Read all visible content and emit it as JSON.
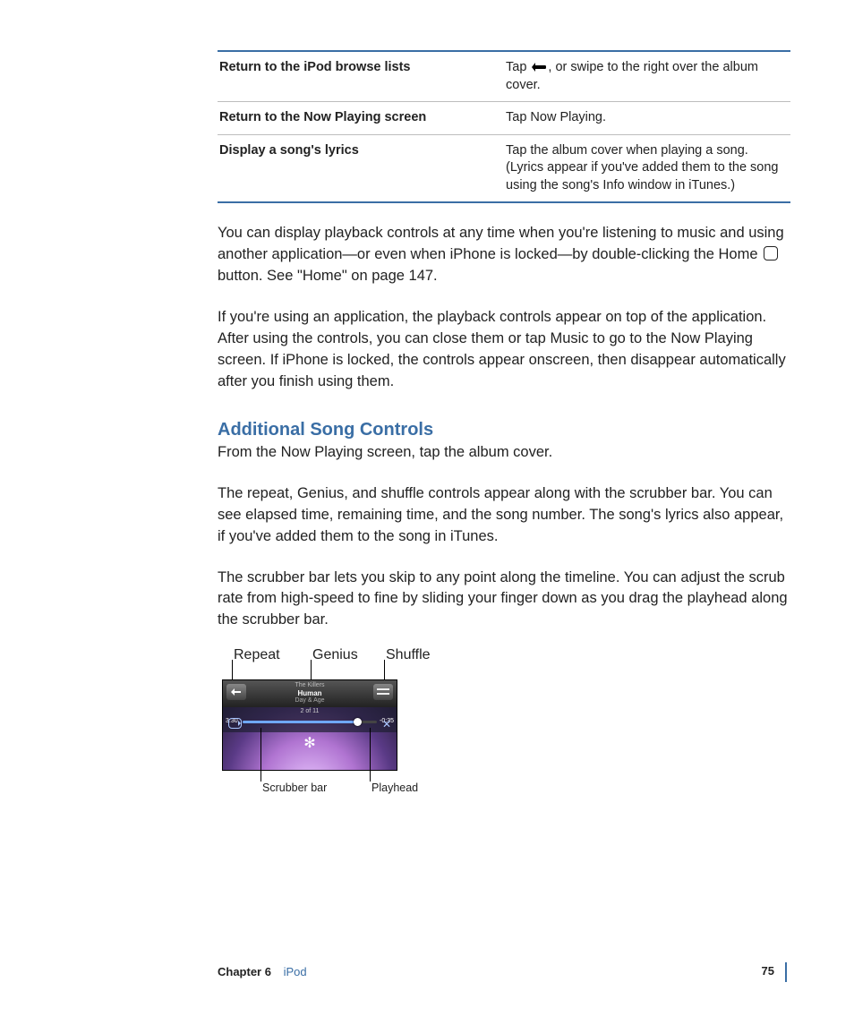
{
  "table": {
    "rows": [
      {
        "left": "Return to the iPod browse lists",
        "right_pre": "Tap ",
        "right_post": ", or swipe to the right over the album cover."
      },
      {
        "left": "Return to the Now Playing screen",
        "right": "Tap Now Playing."
      },
      {
        "left": "Display a song's lyrics",
        "right": "Tap the album cover when playing a song. (Lyrics appear if you've added them to the song using the song's Info window in iTunes.)"
      }
    ]
  },
  "para1_pre": "You can display playback controls at any time when you're listening to music and using another application—or even when iPhone is locked—by double-clicking the Home ",
  "para1_post": " button. See \"Home\" on page 147.",
  "para2": "If you're using an application, the playback controls appear on top of the application. After using the controls, you can close them or tap Music to go to the Now Playing screen. If iPhone is locked, the controls appear onscreen, then disappear automatically after you finish using them.",
  "heading": "Additional Song Controls",
  "para3": "From the Now Playing screen, tap the album cover.",
  "para4": "The repeat, Genius, and shuffle controls appear along with the scrubber bar. You can see elapsed time, remaining time, and the song number. The song's lyrics also appear, if you've added them to the song in iTunes.",
  "para5": "The scrubber bar lets you skip to any point along the timeline. You can adjust the scrub rate from high-speed to fine by sliding your finger down as you drag the playhead along the scrubber bar.",
  "callouts": {
    "repeat": "Repeat",
    "genius": "Genius",
    "shuffle": "Shuffle",
    "scrubber": "Scrubber bar",
    "playhead": "Playhead"
  },
  "now_playing": {
    "artist": "The Killers",
    "song": "Human",
    "album": "Day & Age",
    "track_of": "2 of 11",
    "elapsed": "3:30",
    "remaining": "-0:35"
  },
  "footer": {
    "chapter": "Chapter 6",
    "section": "iPod",
    "page": "75"
  }
}
